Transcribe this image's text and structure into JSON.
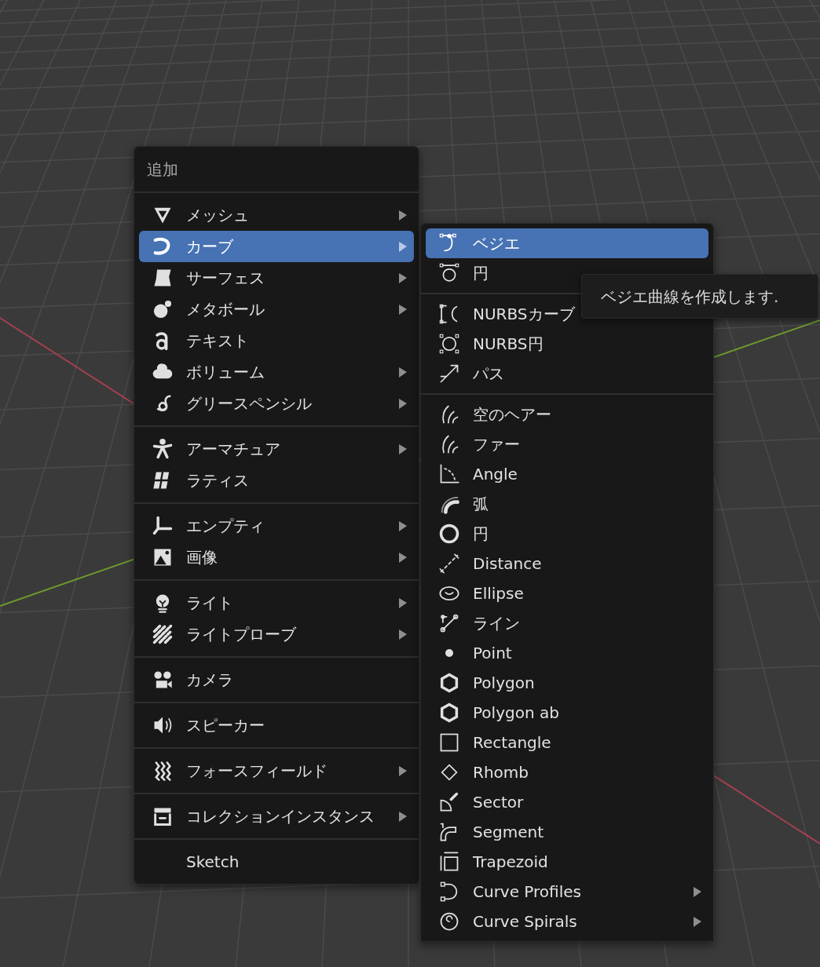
{
  "add_menu": {
    "title": "追加",
    "sections": [
      {
        "items": [
          {
            "label": "メッシュ",
            "submenu": true,
            "selected": false
          },
          {
            "label": "カーブ",
            "submenu": true,
            "selected": true
          },
          {
            "label": "サーフェス",
            "submenu": true,
            "selected": false
          },
          {
            "label": "メタボール",
            "submenu": true,
            "selected": false
          },
          {
            "label": "テキスト",
            "submenu": false,
            "selected": false
          },
          {
            "label": "ボリューム",
            "submenu": true,
            "selected": false
          },
          {
            "label": "グリースペンシル",
            "submenu": true,
            "selected": false
          }
        ]
      },
      {
        "items": [
          {
            "label": "アーマチュア",
            "submenu": true,
            "selected": false
          },
          {
            "label": "ラティス",
            "submenu": false,
            "selected": false
          }
        ]
      },
      {
        "items": [
          {
            "label": "エンプティ",
            "submenu": true,
            "selected": false
          },
          {
            "label": "画像",
            "submenu": true,
            "selected": false
          }
        ]
      },
      {
        "items": [
          {
            "label": "ライト",
            "submenu": true,
            "selected": false
          },
          {
            "label": "ライトプローブ",
            "submenu": true,
            "selected": false
          }
        ]
      },
      {
        "items": [
          {
            "label": "カメラ",
            "submenu": false,
            "selected": false
          }
        ]
      },
      {
        "items": [
          {
            "label": "スピーカー",
            "submenu": false,
            "selected": false
          }
        ]
      },
      {
        "items": [
          {
            "label": "フォースフィールド",
            "submenu": true,
            "selected": false
          }
        ]
      },
      {
        "items": [
          {
            "label": "コレクションインスタンス",
            "submenu": true,
            "selected": false
          }
        ]
      },
      {
        "items": [
          {
            "label": "Sketch",
            "submenu": false,
            "selected": false
          }
        ]
      }
    ]
  },
  "curve_submenu": {
    "sections": [
      {
        "items": [
          {
            "label": "ベジエ",
            "submenu": false,
            "selected": true
          },
          {
            "label": "円",
            "submenu": false,
            "selected": false
          }
        ]
      },
      {
        "items": [
          {
            "label": "NURBSカーブ",
            "submenu": false,
            "selected": false
          },
          {
            "label": "NURBS円",
            "submenu": false,
            "selected": false
          },
          {
            "label": "パス",
            "submenu": false,
            "selected": false
          }
        ]
      },
      {
        "items": [
          {
            "label": "空のヘアー",
            "submenu": false,
            "selected": false
          },
          {
            "label": "ファー",
            "submenu": false,
            "selected": false
          },
          {
            "label": "Angle",
            "submenu": false,
            "selected": false
          },
          {
            "label": "弧",
            "submenu": false,
            "selected": false
          },
          {
            "label": "円",
            "submenu": false,
            "selected": false
          },
          {
            "label": "Distance",
            "submenu": false,
            "selected": false
          },
          {
            "label": "Ellipse",
            "submenu": false,
            "selected": false
          },
          {
            "label": "ライン",
            "submenu": false,
            "selected": false
          },
          {
            "label": "Point",
            "submenu": false,
            "selected": false
          },
          {
            "label": "Polygon",
            "submenu": false,
            "selected": false
          },
          {
            "label": "Polygon ab",
            "submenu": false,
            "selected": false
          },
          {
            "label": "Rectangle",
            "submenu": false,
            "selected": false
          },
          {
            "label": "Rhomb",
            "submenu": false,
            "selected": false
          },
          {
            "label": "Sector",
            "submenu": false,
            "selected": false
          },
          {
            "label": "Segment",
            "submenu": false,
            "selected": false
          },
          {
            "label": "Trapezoid",
            "submenu": false,
            "selected": false
          },
          {
            "label": "Curve Profiles",
            "submenu": true,
            "selected": false
          },
          {
            "label": "Curve Spirals",
            "submenu": true,
            "selected": false
          }
        ]
      }
    ]
  },
  "tooltip": {
    "text": "ベジエ曲線を作成します."
  }
}
